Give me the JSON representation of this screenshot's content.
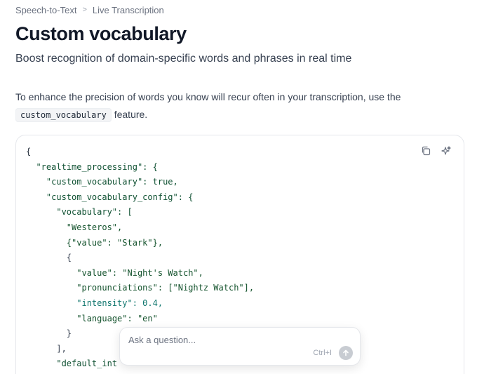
{
  "breadcrumb": {
    "items": [
      "Speech-to-Text",
      "Live Transcription"
    ],
    "separator": ">"
  },
  "page": {
    "title": "Custom vocabulary",
    "subtitle": "Boost recognition of domain-specific words and phrases in real time"
  },
  "intro": {
    "text_before": "To enhance the precision of words you know will recur often in your transcription, use the ",
    "code": "custom_vocabulary",
    "text_after": " feature."
  },
  "code_block": {
    "copy_icon": "copy-icon",
    "ai_icon": "sparkle-icon",
    "lines": [
      "{",
      "  \"realtime_processing\": {",
      "    \"custom_vocabulary\": true,",
      "    \"custom_vocabulary_config\": {",
      "      \"vocabulary\": [",
      "        \"Westeros\",",
      "        {\"value\": \"Stark\"},",
      "        {",
      "          \"value\": \"Night's Watch\",",
      "          \"pronunciations\": [\"Nightz Watch\"],",
      "          \"intensity\": 0.4,",
      "          \"language\": \"en\"",
      "        }",
      "      ],",
      "      \"default_int"
    ]
  },
  "ask_bar": {
    "placeholder": "Ask a question...",
    "shortcut": "Ctrl+I",
    "send_icon": "arrow-up-icon"
  }
}
